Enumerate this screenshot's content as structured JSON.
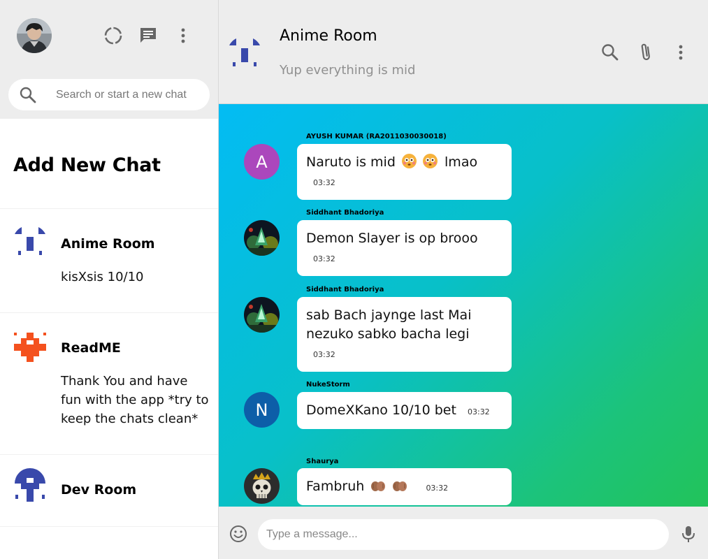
{
  "sidebar": {
    "search": {
      "placeholder": "Search or start a new chat",
      "value": ""
    },
    "add_new_chat_label": "Add New Chat",
    "chats": [
      {
        "name": "Anime Room",
        "last_message": "kisXsis 10/10",
        "avatar_color": "#3949ab"
      },
      {
        "name": "ReadME",
        "last_message": "Thank You and have fun with the app *try to keep the chats clean*",
        "avatar_color": "#f4511e"
      },
      {
        "name": "Dev Room",
        "last_message": "",
        "avatar_color": "#3949ab"
      }
    ],
    "header_icons": [
      "user-avatar",
      "status-icon",
      "new-chat-icon",
      "more-vert-icon"
    ]
  },
  "chat": {
    "title": "Anime Room",
    "subtitle": "Yup everything is mid",
    "header_icons": [
      "search-icon",
      "attach-icon",
      "more-vert-icon"
    ],
    "messages": [
      {
        "sender": "AYUSH KUMAR (RA2011030030018)",
        "text": "Naruto is mid",
        "suffix": "lmao",
        "time": "03:32",
        "avatar_letter": "A",
        "avatar_color": "#ab47bc"
      },
      {
        "sender": "Siddhant Bhadoriya",
        "text": "Demon Slayer is op brooo",
        "time": "03:32"
      },
      {
        "sender": "Siddhant Bhadoriya",
        "text_line1": "sab Bach jaynge last Mai",
        "text_line2": "nezuko sabko bacha legi",
        "time": "03:32"
      },
      {
        "sender": "NukeStorm",
        "text": "DomeXKano 10/10 bet",
        "time": "03:32",
        "avatar_letter": "N",
        "avatar_color": "#0d5ea8"
      },
      {
        "sender": "Shaurya",
        "text": "Fambruh",
        "time": "03:32"
      }
    ],
    "gradient_colors": [
      "#03bcf4",
      "#22c35a"
    ]
  },
  "composer": {
    "placeholder": "Type a message...",
    "value": ""
  }
}
